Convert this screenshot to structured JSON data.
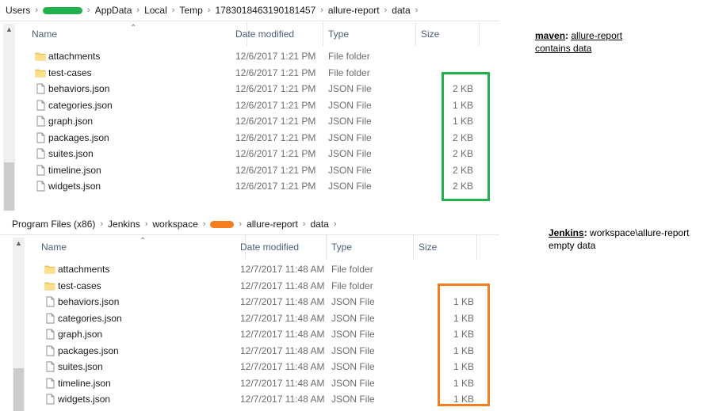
{
  "explorer1": {
    "breadcrumb": [
      "Users",
      "AppData",
      "Local",
      "Temp",
      "1783018463190181457",
      "allure-report",
      "data"
    ],
    "columns": {
      "name": "Name",
      "date": "Date modified",
      "type": "Type",
      "size": "Size"
    },
    "rows": [
      {
        "name": "attachments",
        "date": "12/6/2017 1:21 PM",
        "type": "File folder",
        "size": "",
        "icon": "folder-icon"
      },
      {
        "name": "test-cases",
        "date": "12/6/2017 1:21 PM",
        "type": "File folder",
        "size": "",
        "icon": "folder-icon"
      },
      {
        "name": "behaviors.json",
        "date": "12/6/2017 1:21 PM",
        "type": "JSON File",
        "size": "2 KB",
        "icon": "file-icon"
      },
      {
        "name": "categories.json",
        "date": "12/6/2017 1:21 PM",
        "type": "JSON File",
        "size": "1 KB",
        "icon": "file-icon"
      },
      {
        "name": "graph.json",
        "date": "12/6/2017 1:21 PM",
        "type": "JSON File",
        "size": "1 KB",
        "icon": "file-icon"
      },
      {
        "name": "packages.json",
        "date": "12/6/2017 1:21 PM",
        "type": "JSON File",
        "size": "2 KB",
        "icon": "file-icon"
      },
      {
        "name": "suites.json",
        "date": "12/6/2017 1:21 PM",
        "type": "JSON File",
        "size": "2 KB",
        "icon": "file-icon"
      },
      {
        "name": "timeline.json",
        "date": "12/6/2017 1:21 PM",
        "type": "JSON File",
        "size": "2 KB",
        "icon": "file-icon"
      },
      {
        "name": "widgets.json",
        "date": "12/6/2017 1:21 PM",
        "type": "JSON File",
        "size": "2 KB",
        "icon": "file-icon"
      }
    ],
    "highlight_color": "#22b14c",
    "redaction_color": "#22b14c"
  },
  "explorer2": {
    "breadcrumb": [
      "Program Files (x86)",
      "Jenkins",
      "workspace",
      "allure-report",
      "data"
    ],
    "columns": {
      "name": "Name",
      "date": "Date modified",
      "type": "Type",
      "size": "Size"
    },
    "rows": [
      {
        "name": "attachments",
        "date": "12/7/2017 11:48 AM",
        "type": "File folder",
        "size": "",
        "icon": "folder-icon"
      },
      {
        "name": "test-cases",
        "date": "12/7/2017 11:48 AM",
        "type": "File folder",
        "size": "",
        "icon": "folder-icon"
      },
      {
        "name": "behaviors.json",
        "date": "12/7/2017 11:48 AM",
        "type": "JSON File",
        "size": "1 KB",
        "icon": "file-icon"
      },
      {
        "name": "categories.json",
        "date": "12/7/2017 11:48 AM",
        "type": "JSON File",
        "size": "1 KB",
        "icon": "file-icon"
      },
      {
        "name": "graph.json",
        "date": "12/7/2017 11:48 AM",
        "type": "JSON File",
        "size": "1 KB",
        "icon": "file-icon"
      },
      {
        "name": "packages.json",
        "date": "12/7/2017 11:48 AM",
        "type": "JSON File",
        "size": "1 KB",
        "icon": "file-icon"
      },
      {
        "name": "suites.json",
        "date": "12/7/2017 11:48 AM",
        "type": "JSON File",
        "size": "1 KB",
        "icon": "file-icon"
      },
      {
        "name": "timeline.json",
        "date": "12/7/2017 11:48 AM",
        "type": "JSON File",
        "size": "1 KB",
        "icon": "file-icon"
      },
      {
        "name": "widgets.json",
        "date": "12/7/2017 11:48 AM",
        "type": "JSON File",
        "size": "1 KB",
        "icon": "file-icon"
      }
    ],
    "highlight_color": "#f47d20",
    "redaction_color": "#f47d20"
  },
  "note1": {
    "bold": "maven",
    "colon": ":",
    "line1_rest": "allure-report",
    "line2": "contains data"
  },
  "note2": {
    "bold": "Jenkins",
    "colon": ":",
    "line1_rest": "workspace\\allure-report",
    "line2": "empty data"
  }
}
